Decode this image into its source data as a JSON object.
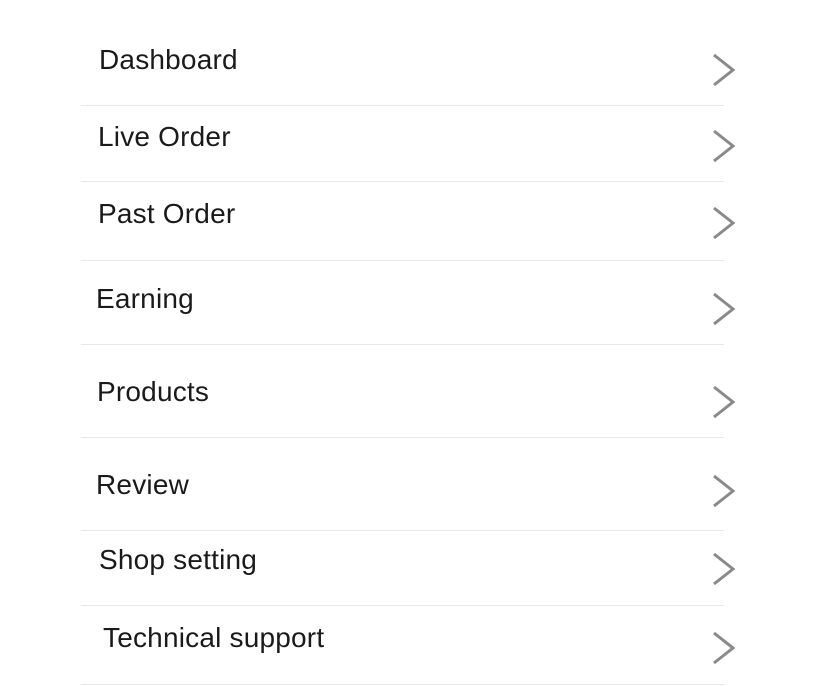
{
  "menu": {
    "items": [
      {
        "label": "Dashboard",
        "icon": "chevron-right-icon"
      },
      {
        "label": "Live Order",
        "icon": "chevron-right-icon"
      },
      {
        "label": "Past Order",
        "icon": "chevron-right-icon"
      },
      {
        "label": "Earning",
        "icon": "chevron-right-icon"
      },
      {
        "label": "Products",
        "icon": "chevron-right-icon"
      },
      {
        "label": "Review",
        "icon": "chevron-right-icon"
      },
      {
        "label": "Shop setting",
        "icon": "chevron-right-icon"
      },
      {
        "label": "Technical support",
        "icon": "chevron-right-icon"
      }
    ]
  },
  "colors": {
    "background": "#ffffff",
    "text": "#1a1a1a",
    "divider": "#e8e8e8",
    "chevron": "#8a8a8a"
  }
}
